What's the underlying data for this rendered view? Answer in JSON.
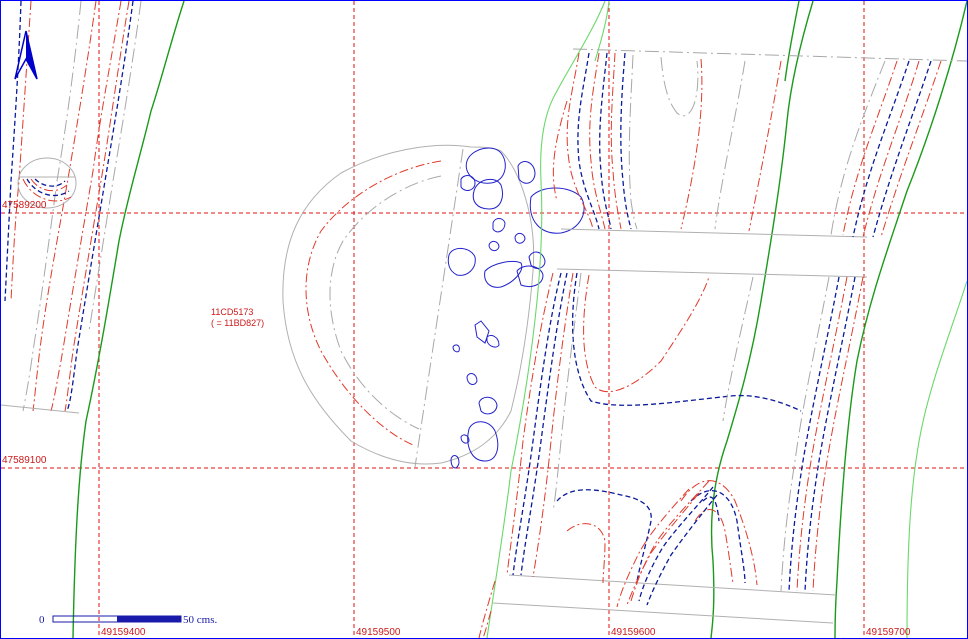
{
  "north_arrow": {
    "icon": "north-arrow-icon",
    "color": "#0000cc"
  },
  "grid": {
    "color": "#e01010",
    "eastings": [
      "49159400",
      "49159500",
      "49159600",
      "49159700"
    ],
    "northings": [
      "47589200",
      "47589100"
    ]
  },
  "feature": {
    "code": "11CD5173",
    "alias": "( = 11BD827)"
  },
  "scale_bar": {
    "start_label": "0",
    "end_label": "50 cms.",
    "color": "#1a1aaa"
  },
  "legend_colors": {
    "contour_primary": "#e03a2a",
    "contour_secondary": "#0a1a9a",
    "excavation_edge": "#1a9a1a",
    "stones": "#2222cc",
    "outline": "#b0b0b0"
  }
}
